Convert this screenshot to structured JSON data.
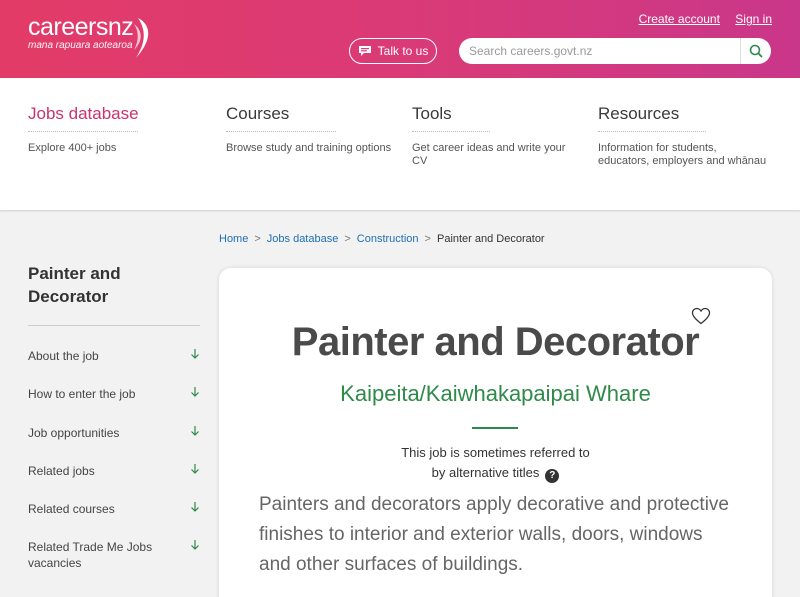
{
  "header": {
    "logo_main": "careers",
    "logo_nz": "nz",
    "logo_sub": "mana rapuara aotearoa",
    "create_account": "Create account",
    "sign_in": "Sign in",
    "talk_label": "Talk to us",
    "search_placeholder": "Search careers.govt.nz"
  },
  "nav": [
    {
      "title": "Jobs database",
      "desc": "Explore 400+ jobs"
    },
    {
      "title": "Courses",
      "desc": "Browse study and training options"
    },
    {
      "title": "Tools",
      "desc": "Get career ideas and write your CV"
    },
    {
      "title": "Resources",
      "desc": "Information for students, educators, employers and whānau"
    }
  ],
  "breadcrumb": [
    "Home",
    "Jobs database",
    "Construction",
    "Painter and Decorator"
  ],
  "sidebar": {
    "title": "Painter and Decorator",
    "items": [
      "About the job",
      "How to enter the job",
      "Job opportunities",
      "Related jobs",
      "Related courses",
      "Related Trade Me Jobs vacancies"
    ]
  },
  "job": {
    "title": "Painter and Decorator",
    "maori_title": "Kaipeita/Kaiwhakapaipai Whare",
    "alt_line1": "This job is sometimes referred to",
    "alt_line2": "by alternative titles",
    "intro": "Painters and decorators apply decorative and protective finishes to interior and exterior walls, doors, windows and other surfaces of buildings."
  },
  "colors": {
    "brand": "#d93a78",
    "accent_green": "#2f8a4a",
    "link": "#1f6fb4"
  }
}
